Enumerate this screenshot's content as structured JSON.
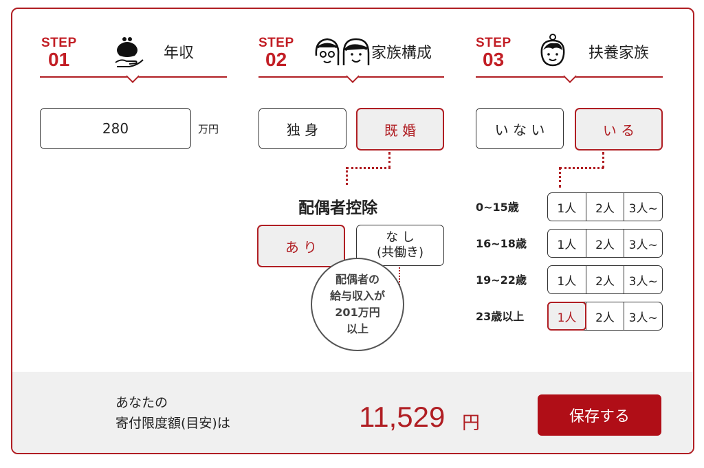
{
  "steps": [
    {
      "word": "STEP",
      "num": "01",
      "title": "年収",
      "icon": "purse-hand-icon"
    },
    {
      "word": "STEP",
      "num": "02",
      "title": "家族構成",
      "icon": "couple-icon"
    },
    {
      "word": "STEP",
      "num": "03",
      "title": "扶養家族",
      "icon": "child-icon"
    }
  ],
  "income": {
    "value": "280",
    "unit": "万円"
  },
  "marital": {
    "single": "独 身",
    "married": "既 婚",
    "selected": "married"
  },
  "spouse": {
    "heading": "配偶者控除",
    "yes": "あ り",
    "no_line1": "な し",
    "no_line2": "(共働き)",
    "selected": "yes",
    "tooltip": [
      "配偶者の",
      "給与収入が",
      "201万円",
      "以上"
    ]
  },
  "dependents": {
    "none": "い な い",
    "some": "い る",
    "selected": "some",
    "rows": [
      {
        "label": "0~15歳",
        "options": [
          "1人",
          "2人",
          "3人~"
        ],
        "selected": null
      },
      {
        "label": "16~18歳",
        "options": [
          "1人",
          "2人",
          "3人~"
        ],
        "selected": null
      },
      {
        "label": "19~22歳",
        "options": [
          "1人",
          "2人",
          "3人~"
        ],
        "selected": null
      },
      {
        "label": "23歳以上",
        "options": [
          "1人",
          "2人",
          "3人~"
        ],
        "selected": 0
      }
    ]
  },
  "result": {
    "label_line1": "あなたの",
    "label_line2": "寄付限度額(目安)は",
    "amount": "11,529",
    "unit": "円"
  },
  "save_button": "保存する",
  "colors": {
    "accent": "#b01e23",
    "step_red": "#c21e25",
    "footer_bg": "#f0f0f0",
    "selected_bg": "#efefef"
  }
}
